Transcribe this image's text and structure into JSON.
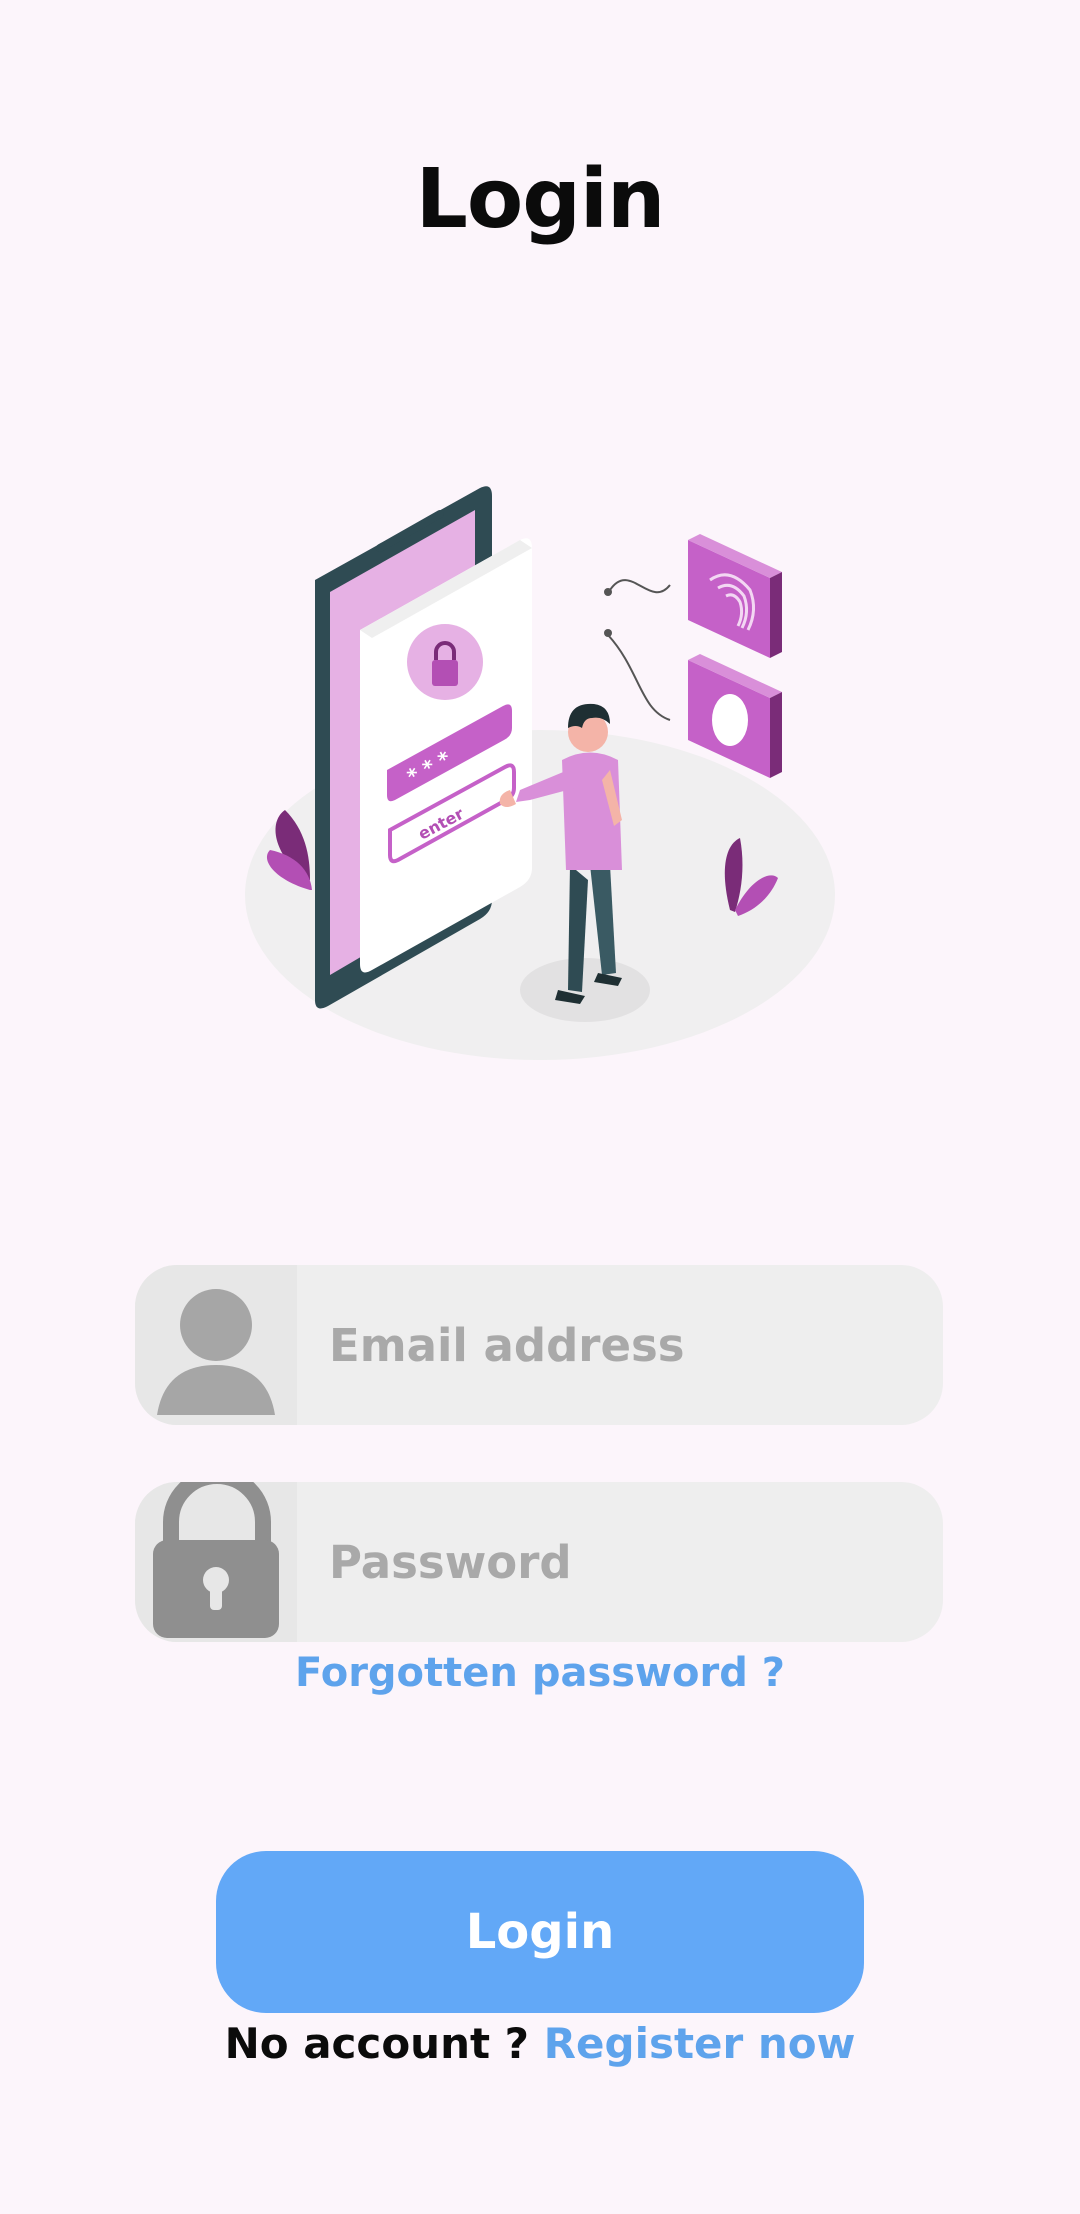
{
  "page": {
    "title": "Login"
  },
  "illustration": {
    "icon": "phone-login-illustration",
    "screen_button_text": "enter"
  },
  "form": {
    "email": {
      "placeholder": "Email address",
      "value": "",
      "icon": "user-icon"
    },
    "password": {
      "placeholder": "Password",
      "value": "",
      "icon": "lock-icon"
    },
    "forgot_label": "Forgotten password ?",
    "login_label": "Login"
  },
  "register": {
    "prompt": "No account ?",
    "link_label": "Register now"
  },
  "colors": {
    "background": "#fcf5fb",
    "accent_blue": "#62a8f7",
    "link_blue": "#5ea3ec",
    "illustration_purple": "#c561c8",
    "field_bg": "#eeeeee",
    "placeholder_gray": "#a9a9a9"
  }
}
